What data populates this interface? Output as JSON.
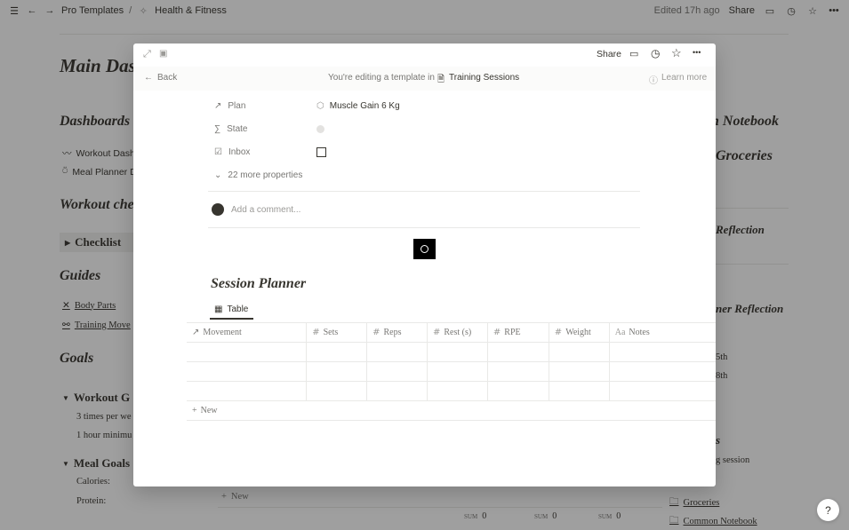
{
  "topbar": {
    "breadcrumb": [
      "Pro Templates",
      "/",
      "Health & Fitness"
    ],
    "edited": "Edited 17h ago",
    "share": "Share"
  },
  "background": {
    "title": "Main Das",
    "left": {
      "dashboards": "Dashboards",
      "workout_dash": "Workout Dashb",
      "meal_planner": "Meal Planner D",
      "workout_check": "Workout che",
      "checklist": "Checklist",
      "guides": "Guides",
      "body_parts": "Body Parts",
      "training_moves": "Training Move",
      "goals": "Goals",
      "workout_goals": "Workout G",
      "times_per_week": "3 times per we",
      "hour_min": "1 hour minimu",
      "meal_goals": "Meal Goals",
      "calories": "Calories:",
      "protein": "Protein:"
    },
    "right": {
      "notebook": "n Notebook",
      "groceries_h": "Groceries",
      "reflection1": "Reflection",
      "reflection2": "ner Reflection",
      "d5": "5th",
      "d8": "8th",
      "s": "s",
      "session": "g session",
      "groceries": "Groceries",
      "common_notebook": "Common Notebook"
    },
    "bottom": {
      "new": "New",
      "sum1_label": "SUM",
      "sum1": "0",
      "sum2_label": "SUM",
      "sum2": "0",
      "sum3_label": "SUM",
      "sum3": "0"
    },
    "help": "?"
  },
  "modal": {
    "share": "Share",
    "back": "Back",
    "banner_text": "You're editing a template in",
    "banner_db": "Training Sessions",
    "learn_more": "Learn more",
    "properties": [
      {
        "label": "Plan",
        "value": "Muscle Gain 6 Kg"
      },
      {
        "label": "State",
        "value": ""
      },
      {
        "label": "Inbox",
        "value": ""
      }
    ],
    "more_props": "22 more properties",
    "comment_placeholder": "Add a comment...",
    "section_title": "Session Planner",
    "view_tab": "Table",
    "columns": [
      "Movement",
      "Sets",
      "Reps",
      "Rest (s)",
      "RPE",
      "Weight",
      "Notes"
    ],
    "rows": [
      [
        "",
        "",
        "",
        "",
        "",
        "",
        ""
      ],
      [
        "",
        "",
        "",
        "",
        "",
        "",
        ""
      ],
      [
        "",
        "",
        "",
        "",
        "",
        "",
        ""
      ]
    ],
    "new_row": "New"
  }
}
